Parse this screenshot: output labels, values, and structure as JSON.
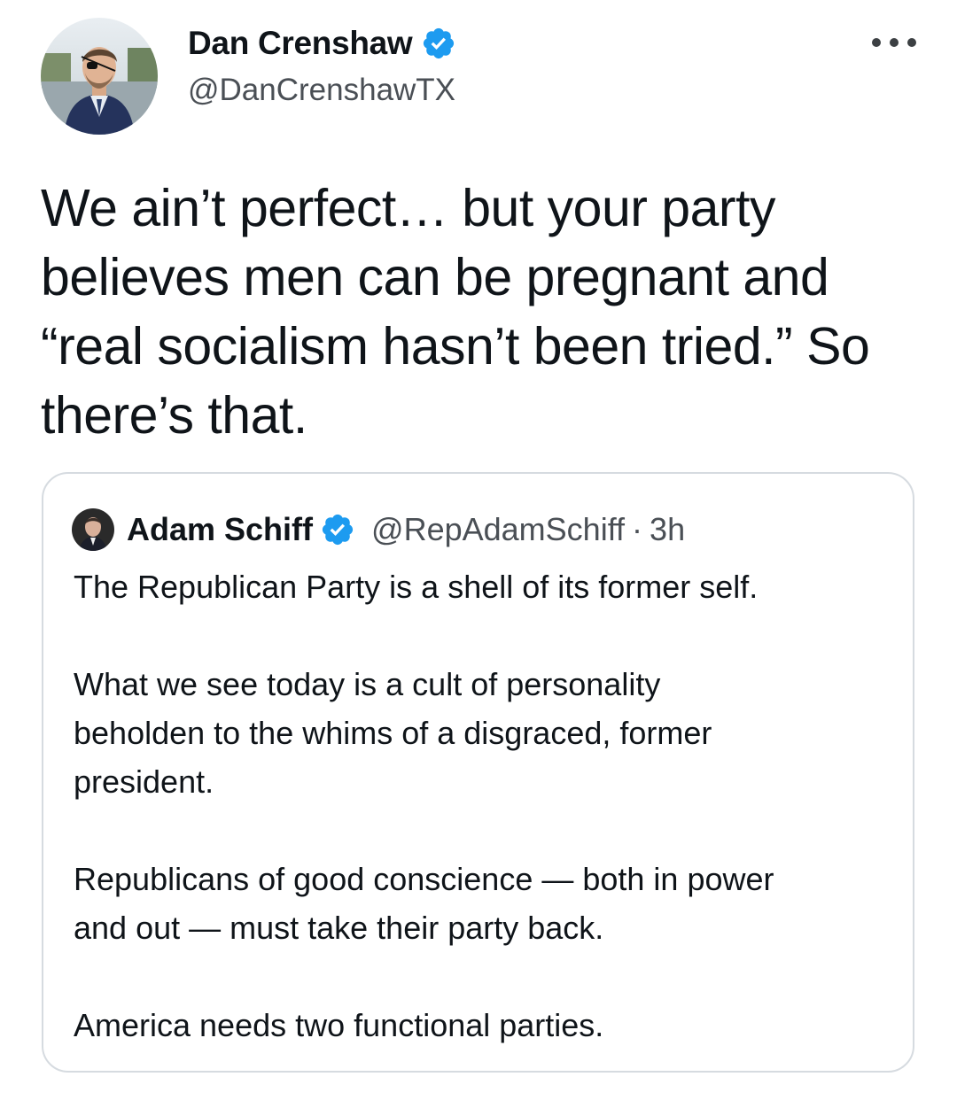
{
  "author": {
    "display_name": "Dan Crenshaw",
    "handle": "@DanCrenshawTX",
    "verified": true
  },
  "tweet": {
    "text": "We ain’t perfect… but your party\nbelieves men can be pregnant and\n“real socialism hasn’t been tried.” So\nthere’s that."
  },
  "menu": {
    "icon": "more-horizontal-icon"
  },
  "quoted_tweet": {
    "display_name": "Adam Schiff",
    "handle": "@RepAdamSchiff",
    "separator": "·",
    "time": "3h",
    "verified": true,
    "paragraphs": [
      "The Republican Party is a shell of its former self.",
      "What we see today is a cult of personality\nbeholden to the whims of a disgraced, former\npresident.",
      "Republicans of good conscience — both in power\nand out — must take their party back.",
      "America needs two functional parties."
    ]
  },
  "colors": {
    "verified_blue": "#1d9bf0",
    "text_primary": "#0f1419",
    "text_secondary": "#4a4f55",
    "card_border": "#d6dbe0"
  }
}
